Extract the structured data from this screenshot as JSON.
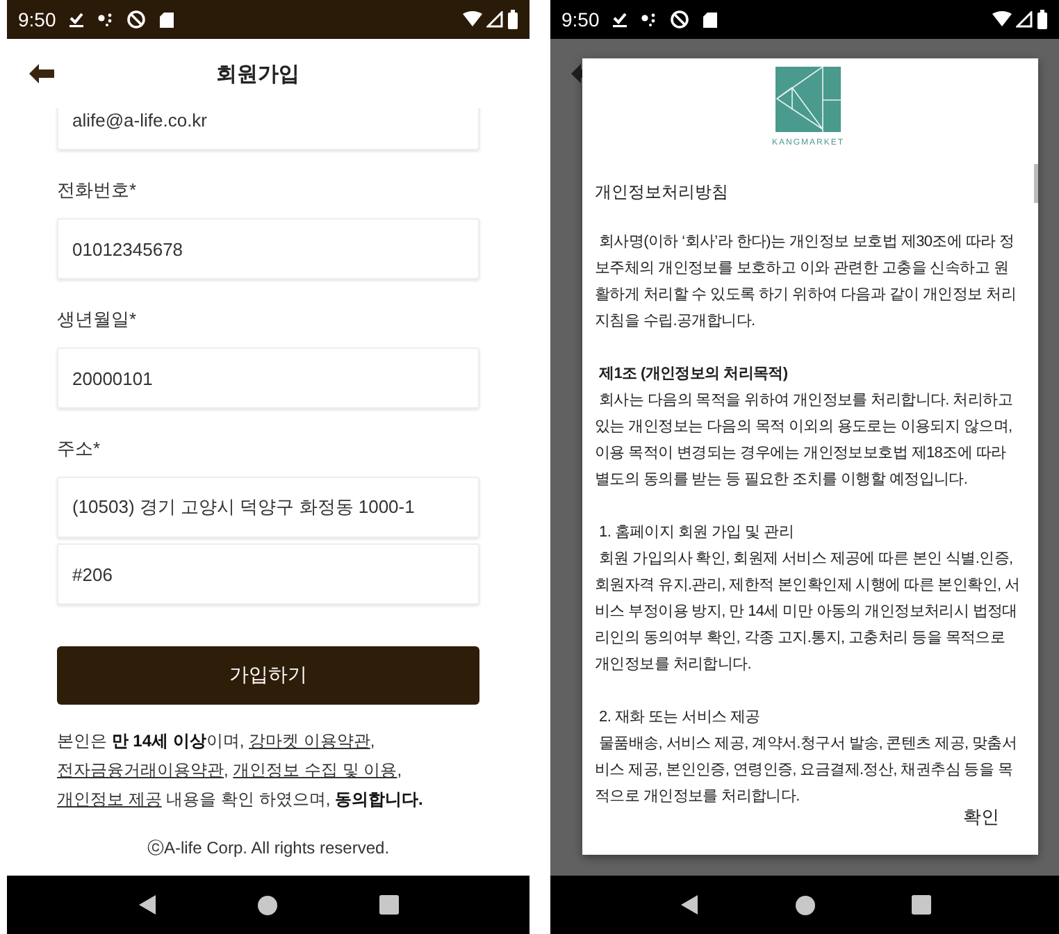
{
  "screens": [
    {
      "kind": "signup",
      "status_bar": {
        "time": "9:50"
      },
      "title": "회원가입",
      "fields": [
        {
          "value": "alife@a-life.co.kr"
        },
        {
          "label": "전화번호*",
          "value": "01012345678"
        },
        {
          "label": "생년월일*",
          "value": "20000101"
        },
        {
          "label": "주소*",
          "value": "(10503) 경기 고양시 덕양구 화정동 1000-1"
        },
        {
          "value": "#206"
        }
      ],
      "submit_button": "가입하기",
      "agreement": [
        {
          "kind": "plain",
          "text": "본인은 "
        },
        {
          "kind": "bold",
          "text": "만 14세 이상"
        },
        {
          "kind": "plain",
          "text": "이며, "
        },
        {
          "kind": "link",
          "text": "강마켓 이용약관"
        },
        {
          "kind": "plain",
          "text": ", "
        },
        {
          "kind": "link",
          "text": "전자금융거래이용약관"
        },
        {
          "kind": "plain",
          "text": ", "
        },
        {
          "kind": "link",
          "text": "개인정보 수집 및 이용"
        },
        {
          "kind": "plain",
          "text": ", "
        },
        {
          "kind": "link",
          "text": "개인정보 제공"
        },
        {
          "kind": "plain",
          "text": " 내용을 확인 하였으며, "
        },
        {
          "kind": "bold",
          "text": "동의합니다."
        }
      ],
      "copyright": "ⓒA-life Corp. All rights reserved."
    },
    {
      "kind": "policy_dialog",
      "status_bar": {
        "time": "9:50"
      },
      "dialog": {
        "brand": "KANGMARKET",
        "title": "개인정보처리방침",
        "blocks": [
          {
            "kind": "paragraph",
            "body": "회사명(이하 ‘회사’라 한다)는 개인정보 보호법 제30조에 따라 정보주체의 개인정보를 보호하고 이와 관련한 고충을 신속하고 원활하게 처리할 수 있도록 하기 위하여 다음과 같이 개인정보 처리지침을 수립.공개합니다."
          },
          {
            "kind": "article",
            "heading": "제1조 (개인정보의 처리목적)",
            "body": "회사는 다음의 목적을 위하여 개인정보를 처리합니다. 처리하고 있는 개인정보는 다음의 목적 이외의 용도로는 이용되지 않으며, 이용 목적이 변경되는 경우에는 개인정보보호법 제18조에 따라 별도의 동의를 받는 등 필요한 조치를 이행할 예정입니다."
          },
          {
            "kind": "item",
            "heading": "1. 홈페이지 회원 가입 및 관리",
            "body": "회원 가입의사 확인, 회원제 서비스 제공에 따른 본인 식별.인증, 회원자격 유지.관리, 제한적 본인확인제 시행에 따른 본인확인, 서비스 부정이용 방지, 만 14세 미만 아동의 개인정보처리시 법정대리인의 동의여부 확인, 각종 고지.통지, 고충처리 등을 목적으로 개인정보를 처리합니다."
          },
          {
            "kind": "item",
            "heading": "2. 재화 또는 서비스 제공",
            "body": "물품배송, 서비스 제공, 계약서.청구서 발송, 콘텐츠 제공, 맞춤서비스 제공, 본인인증, 연령인증, 요금결제.정산, 채권추심 등을 목적으로 개인정보를 처리합니다."
          }
        ],
        "confirm_button": "확인"
      }
    }
  ]
}
